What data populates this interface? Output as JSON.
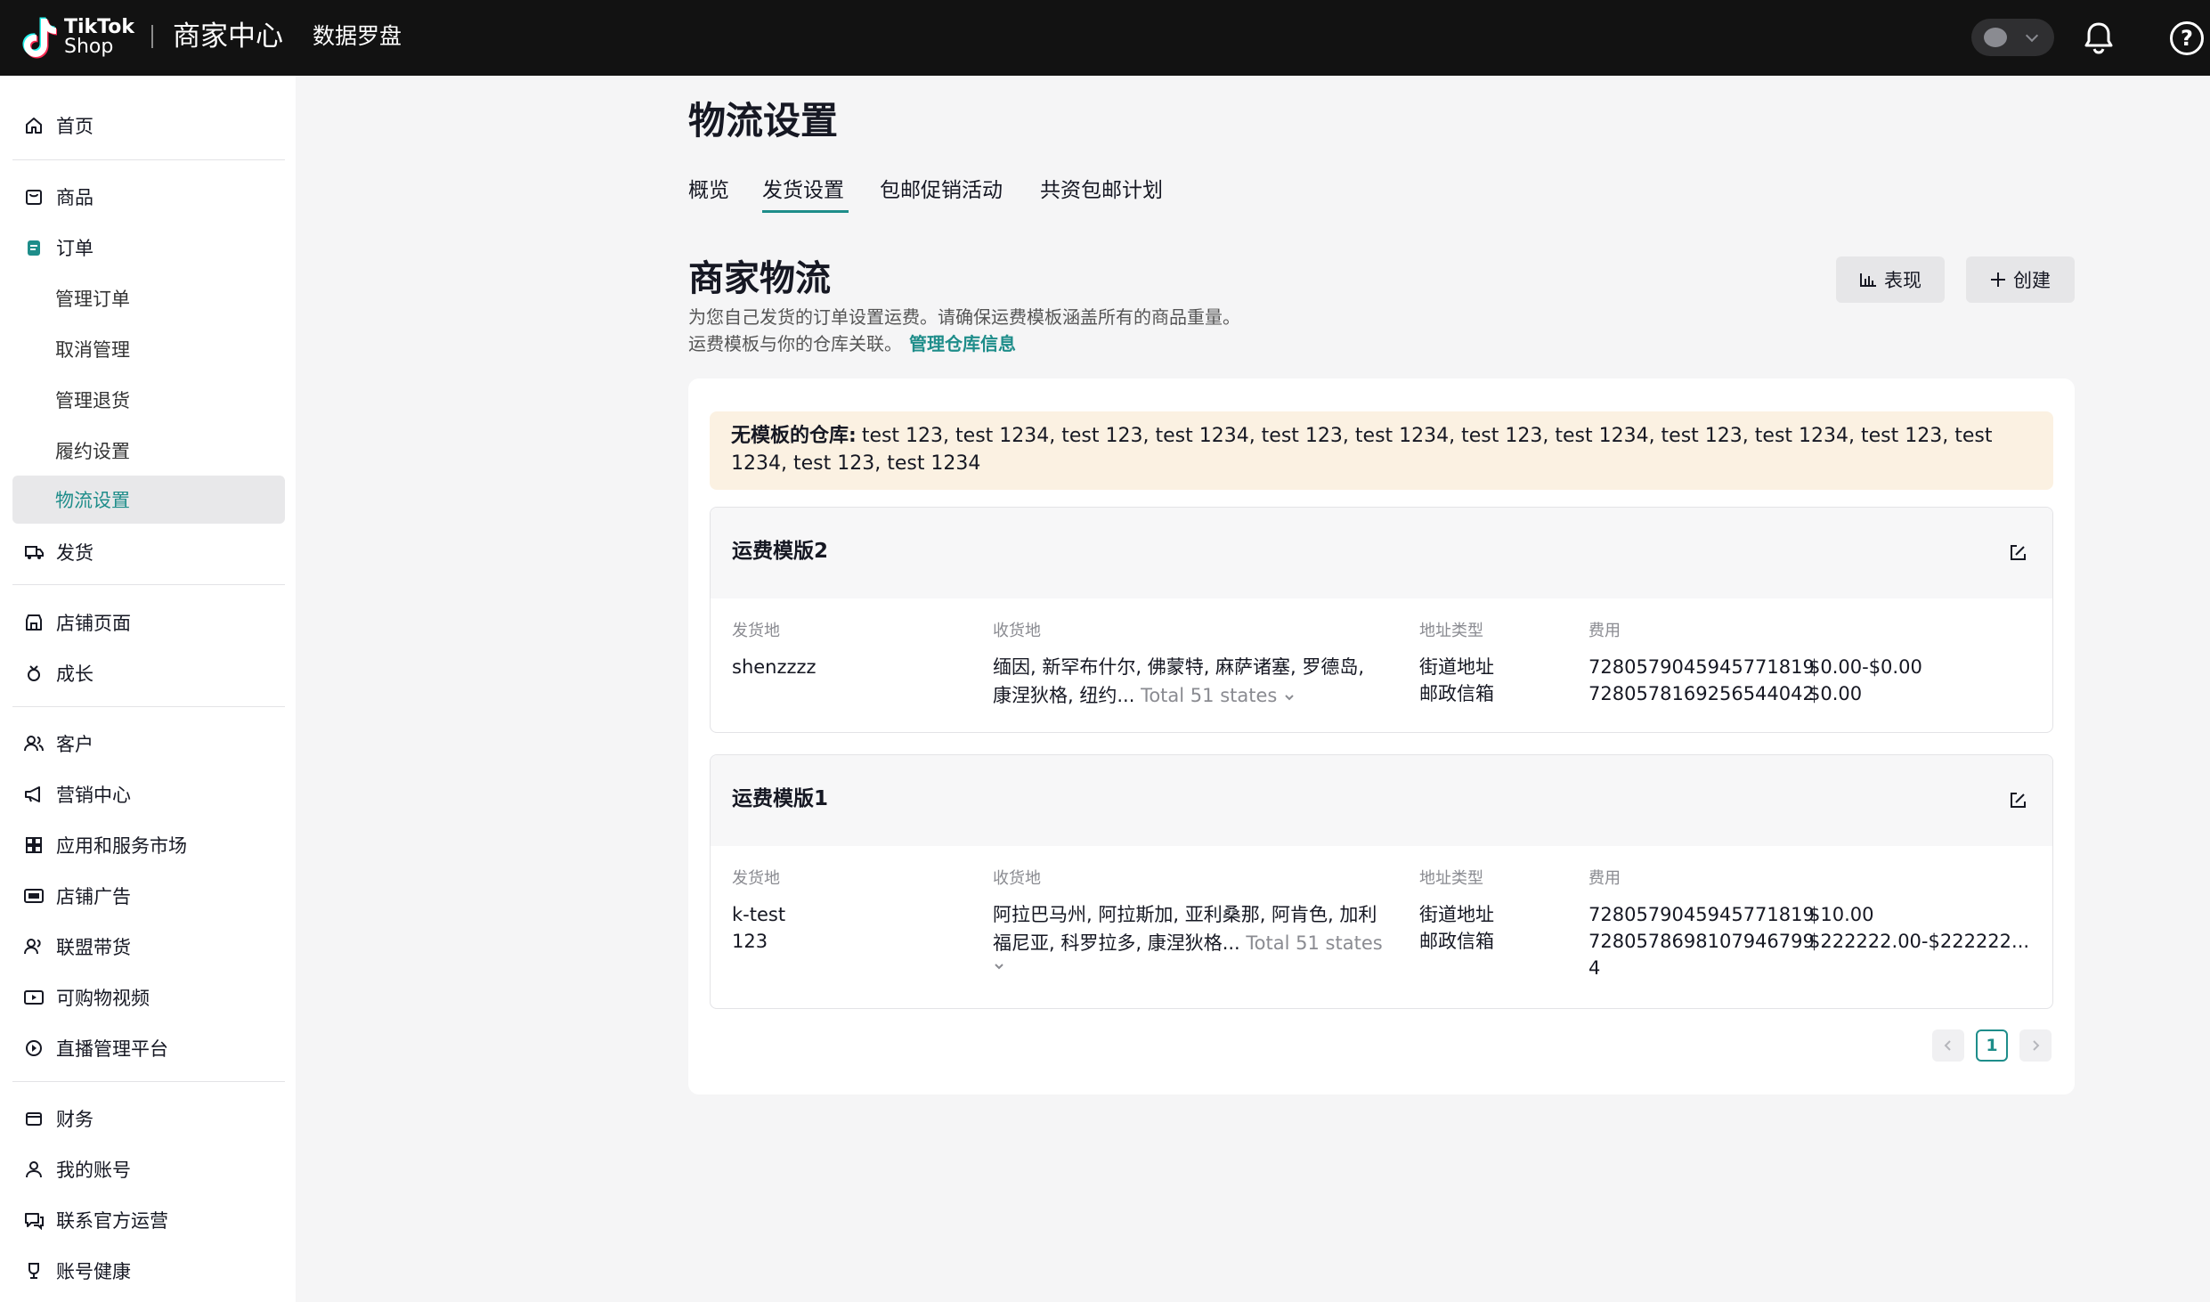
{
  "topbar": {
    "logo_brand": "TikTok",
    "logo_sub": "Shop",
    "title": "商家中心",
    "data_link": "数据罗盘",
    "help_icon": "?"
  },
  "sidebar": {
    "items": [
      {
        "label": "首页",
        "icon": "home-icon"
      },
      {
        "label": "商品",
        "icon": "product-icon"
      },
      {
        "label": "订单",
        "icon": "order-icon"
      },
      {
        "label": "管理订单"
      },
      {
        "label": "取消管理"
      },
      {
        "label": "管理退货"
      },
      {
        "label": "履约设置"
      },
      {
        "label": "物流设置"
      },
      {
        "label": "发货",
        "icon": "shipping-icon"
      },
      {
        "label": "店铺页面",
        "icon": "store-icon"
      },
      {
        "label": "成长",
        "icon": "growth-icon"
      },
      {
        "label": "客户",
        "icon": "customers-icon"
      },
      {
        "label": "营销中心",
        "icon": "megaphone-icon"
      },
      {
        "label": "应用和服务市场",
        "icon": "apps-icon"
      },
      {
        "label": "店铺广告",
        "icon": "ad-icon"
      },
      {
        "label": "联盟带货",
        "icon": "affiliate-icon"
      },
      {
        "label": "可购物视频",
        "icon": "video-icon"
      },
      {
        "label": "直播管理平台",
        "icon": "live-icon"
      },
      {
        "label": "财务",
        "icon": "finance-icon"
      },
      {
        "label": "我的账号",
        "icon": "account-icon"
      },
      {
        "label": "联系官方运营",
        "icon": "contact-icon"
      },
      {
        "label": "账号健康",
        "icon": "trophy-icon"
      }
    ]
  },
  "main": {
    "title": "物流设置",
    "tabs": [
      "概览",
      "发货设置",
      "包邮促销活动",
      "共资包邮计划"
    ],
    "active_tab": "发货设置",
    "section_title": "商家物流",
    "desc_line1": "为您自己发货的订单设置运费。请确保运费模板涵盖所有的商品重量。",
    "desc_line2": "运费模板与你的仓库关联。",
    "desc_link": "管理仓库信息",
    "btn_performance": "表现",
    "btn_create": "创建",
    "warning_label": "无模板的仓库:",
    "warning_text": "test 123, test 1234, test 123, test 1234, test 123, test 1234, test 123, test 1234, test 123, test 1234, test 123, test 1234, test 123, test 1234"
  },
  "columns": {
    "origin": "发货地",
    "destination": "收货地",
    "address_type": "地址类型",
    "fee": "费用"
  },
  "templates": [
    {
      "name": "运费模版2",
      "origin_lines": [
        "shenzzzz"
      ],
      "dest_line1": "缅因, 新罕布什尔, 佛蒙特, 麻萨诸塞, 罗德岛,",
      "dest_line2": "康涅狄格, 纽约...",
      "dest_total": "Total 51 states",
      "addr_types": [
        "街道地址",
        "邮政信箱"
      ],
      "fees": [
        {
          "id": "7280579045945771819",
          "amount": "$0.00-$0.00"
        },
        {
          "id": "7280578169256544042",
          "amount": "$0.00"
        }
      ]
    },
    {
      "name": "运费模版1",
      "origin_lines": [
        "k-test",
        "123"
      ],
      "dest_line1": "阿拉巴马州, 阿拉斯加, 亚利桑那, 阿肯色, 加利",
      "dest_line2": "福尼亚, 科罗拉多, 康涅狄格...",
      "dest_total": "Total 51 states",
      "addr_types": [
        "街道地址",
        "邮政信箱"
      ],
      "fees": [
        {
          "id": "7280579045945771819",
          "amount": "$10.00"
        },
        {
          "id": "7280578698107946799",
          "amount": "$222222.00-$222222..."
        }
      ],
      "fee_extra": "4"
    }
  ],
  "pagination": {
    "current": "1"
  },
  "colors": {
    "accent": "#1e8d8a",
    "topbar": "#121212",
    "warning_bg": "#fbf1e2"
  }
}
